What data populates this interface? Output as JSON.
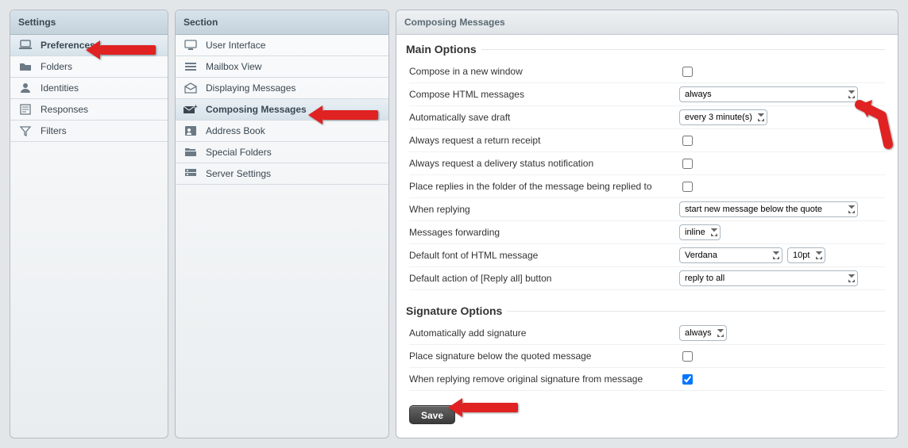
{
  "settings_panel": {
    "title": "Settings",
    "items": [
      {
        "label": "Preferences",
        "icon": "laptop",
        "selected": true
      },
      {
        "label": "Folders",
        "icon": "folder"
      },
      {
        "label": "Identities",
        "icon": "person"
      },
      {
        "label": "Responses",
        "icon": "note"
      },
      {
        "label": "Filters",
        "icon": "filter"
      }
    ]
  },
  "section_panel": {
    "title": "Section",
    "items": [
      {
        "label": "User Interface",
        "icon": "monitor"
      },
      {
        "label": "Mailbox View",
        "icon": "list"
      },
      {
        "label": "Displaying Messages",
        "icon": "mail-open"
      },
      {
        "label": "Composing Messages",
        "icon": "mail-compose",
        "selected": true
      },
      {
        "label": "Address Book",
        "icon": "contact"
      },
      {
        "label": "Special Folders",
        "icon": "special-folders"
      },
      {
        "label": "Server Settings",
        "icon": "server"
      }
    ]
  },
  "content": {
    "title": "Composing Messages",
    "main_options": {
      "legend": "Main Options",
      "rows": [
        {
          "label": "Compose in a new window",
          "type": "checkbox",
          "checked": false
        },
        {
          "label": "Compose HTML messages",
          "type": "select",
          "value": "always",
          "wide": true
        },
        {
          "label": "Automatically save draft",
          "type": "select",
          "value": "every 3 minute(s)"
        },
        {
          "label": "Always request a return receipt",
          "type": "checkbox",
          "checked": false
        },
        {
          "label": "Always request a delivery status notification",
          "type": "checkbox",
          "checked": false
        },
        {
          "label": "Place replies in the folder of the message being replied to",
          "type": "checkbox",
          "checked": false
        },
        {
          "label": "When replying",
          "type": "select",
          "value": "start new message below the quote",
          "wide": true
        },
        {
          "label": "Messages forwarding",
          "type": "select",
          "value": "inline"
        },
        {
          "label": "Default font of HTML message",
          "type": "font",
          "font": "Verdana",
          "size": "10pt"
        },
        {
          "label": "Default action of [Reply all] button",
          "type": "select",
          "value": "reply to all",
          "wide": true
        }
      ]
    },
    "signature_options": {
      "legend": "Signature Options",
      "rows": [
        {
          "label": "Automatically add signature",
          "type": "select",
          "value": "always"
        },
        {
          "label": "Place signature below the quoted message",
          "type": "checkbox",
          "checked": false
        },
        {
          "label": "When replying remove original signature from message",
          "type": "checkbox",
          "checked": true
        }
      ]
    },
    "save_label": "Save"
  }
}
